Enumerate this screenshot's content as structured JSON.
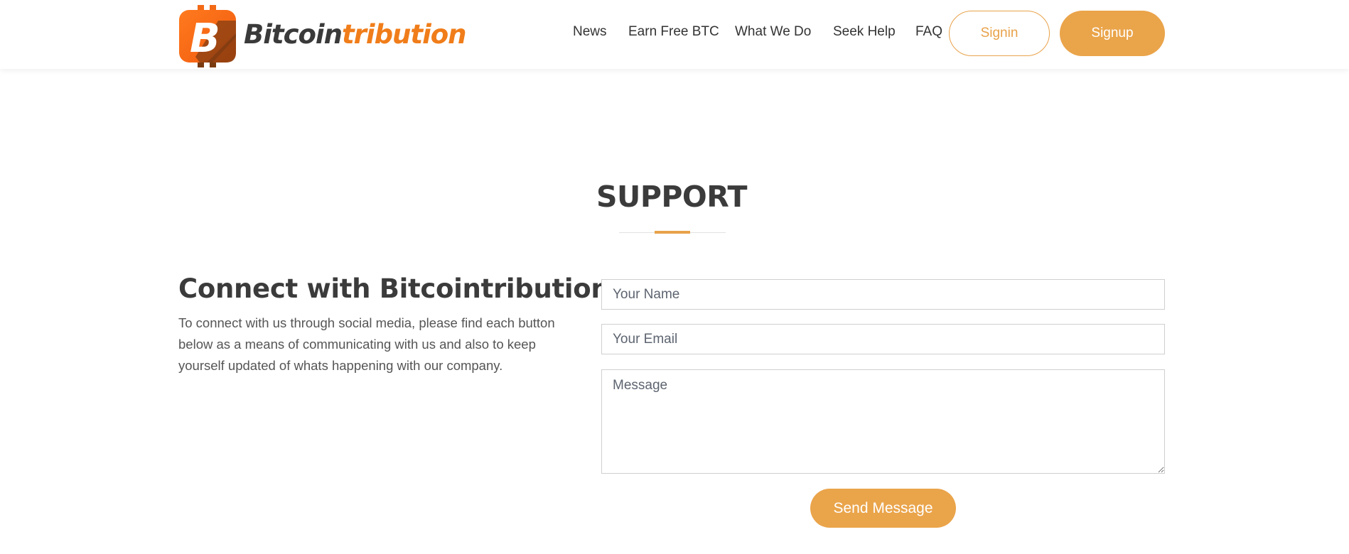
{
  "header": {
    "logo": {
      "mark_letter": "B",
      "text_part1": "Bitcoin",
      "text_part2": "tribution"
    },
    "nav": [
      {
        "label": "News"
      },
      {
        "label": "Earn Free BTC"
      },
      {
        "label": "What We Do"
      },
      {
        "label": "Seek Help"
      },
      {
        "label": "FAQ"
      }
    ],
    "signin_label": "Signin",
    "signup_label": "Signup"
  },
  "support": {
    "title": "SUPPORT",
    "heading": "Connect with Bitcointribution",
    "description": "To connect with us through social media, please find each button below as a means of communicating with us and also to keep yourself updated of whats happening with our company.",
    "form": {
      "name_placeholder": "Your Name",
      "email_placeholder": "Your Email",
      "message_placeholder": "Message",
      "submit_label": "Send Message"
    }
  },
  "colors": {
    "accent": "#eaa44a",
    "logo_orange": "#f07d1a",
    "text_dark": "#3b3b3b"
  },
  "icons": {
    "logo": "bitcoin-b-icon"
  }
}
